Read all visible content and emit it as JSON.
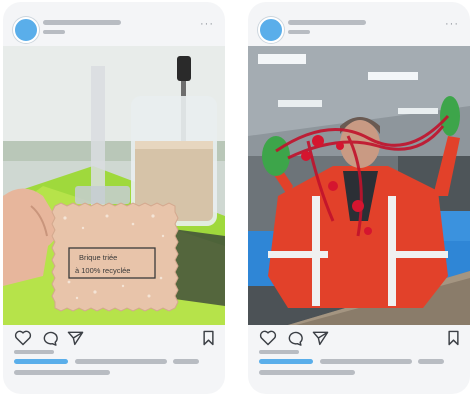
{
  "posts": [
    {
      "photo": {
        "stamp_line1": "Brique triée",
        "stamp_line2": "à 100% recyclée"
      },
      "icons": [
        "heart-icon",
        "comment-icon",
        "share-icon",
        "bookmark-icon"
      ]
    },
    {
      "photo": {},
      "icons": [
        "heart-icon",
        "comment-icon",
        "share-icon",
        "bookmark-icon"
      ]
    }
  ],
  "more_glyph": "···",
  "colors": {
    "avatar": "#5aaeea",
    "placeholder_gray": "#b8bcc2",
    "accent_blue": "#5aaeea",
    "card_bg": "#f4f5f7"
  }
}
